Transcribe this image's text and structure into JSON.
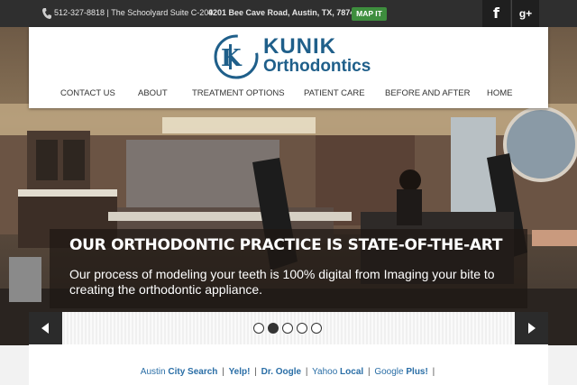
{
  "topbar": {
    "phone_and_suite": "512-327-8818 | The Schoolyard Suite C-209",
    "address": "4201 Bee Cave Road, Austin, TX, 78746",
    "map_button": "MAP IT",
    "facebook_glyph": "f",
    "googleplus_glyph": "g+"
  },
  "brand": {
    "name": "KUNIK",
    "subtitle": "Orthodontics",
    "color": "#1f5f8a"
  },
  "nav": {
    "items": [
      "CONTACT US",
      "ABOUT",
      "TREATMENT OPTIONS",
      "PATIENT CARE",
      "BEFORE AND AFTER",
      "HOME"
    ]
  },
  "slide": {
    "title": "OUR ORTHODONTIC PRACTICE IS STATE-OF-THE-ART",
    "text": "Our process of modeling your teeth is 100% digital from Imaging your bite to creating the orthodontic appliance.",
    "active_index": 2,
    "total": 5
  },
  "footer": {
    "links": [
      {
        "prefix": "Austin ",
        "bold": "City Search"
      },
      {
        "prefix": "",
        "bold": "Yelp!"
      },
      {
        "prefix": "",
        "bold": "Dr. Oogle"
      },
      {
        "prefix": "Yahoo ",
        "bold": "Local"
      },
      {
        "prefix": "Google ",
        "bold": "Plus!"
      }
    ],
    "separator": "|"
  },
  "colors": {
    "accent": "#1f5f8a",
    "map_button": "#3e8e3e",
    "topbar": "#2f2f2f"
  }
}
